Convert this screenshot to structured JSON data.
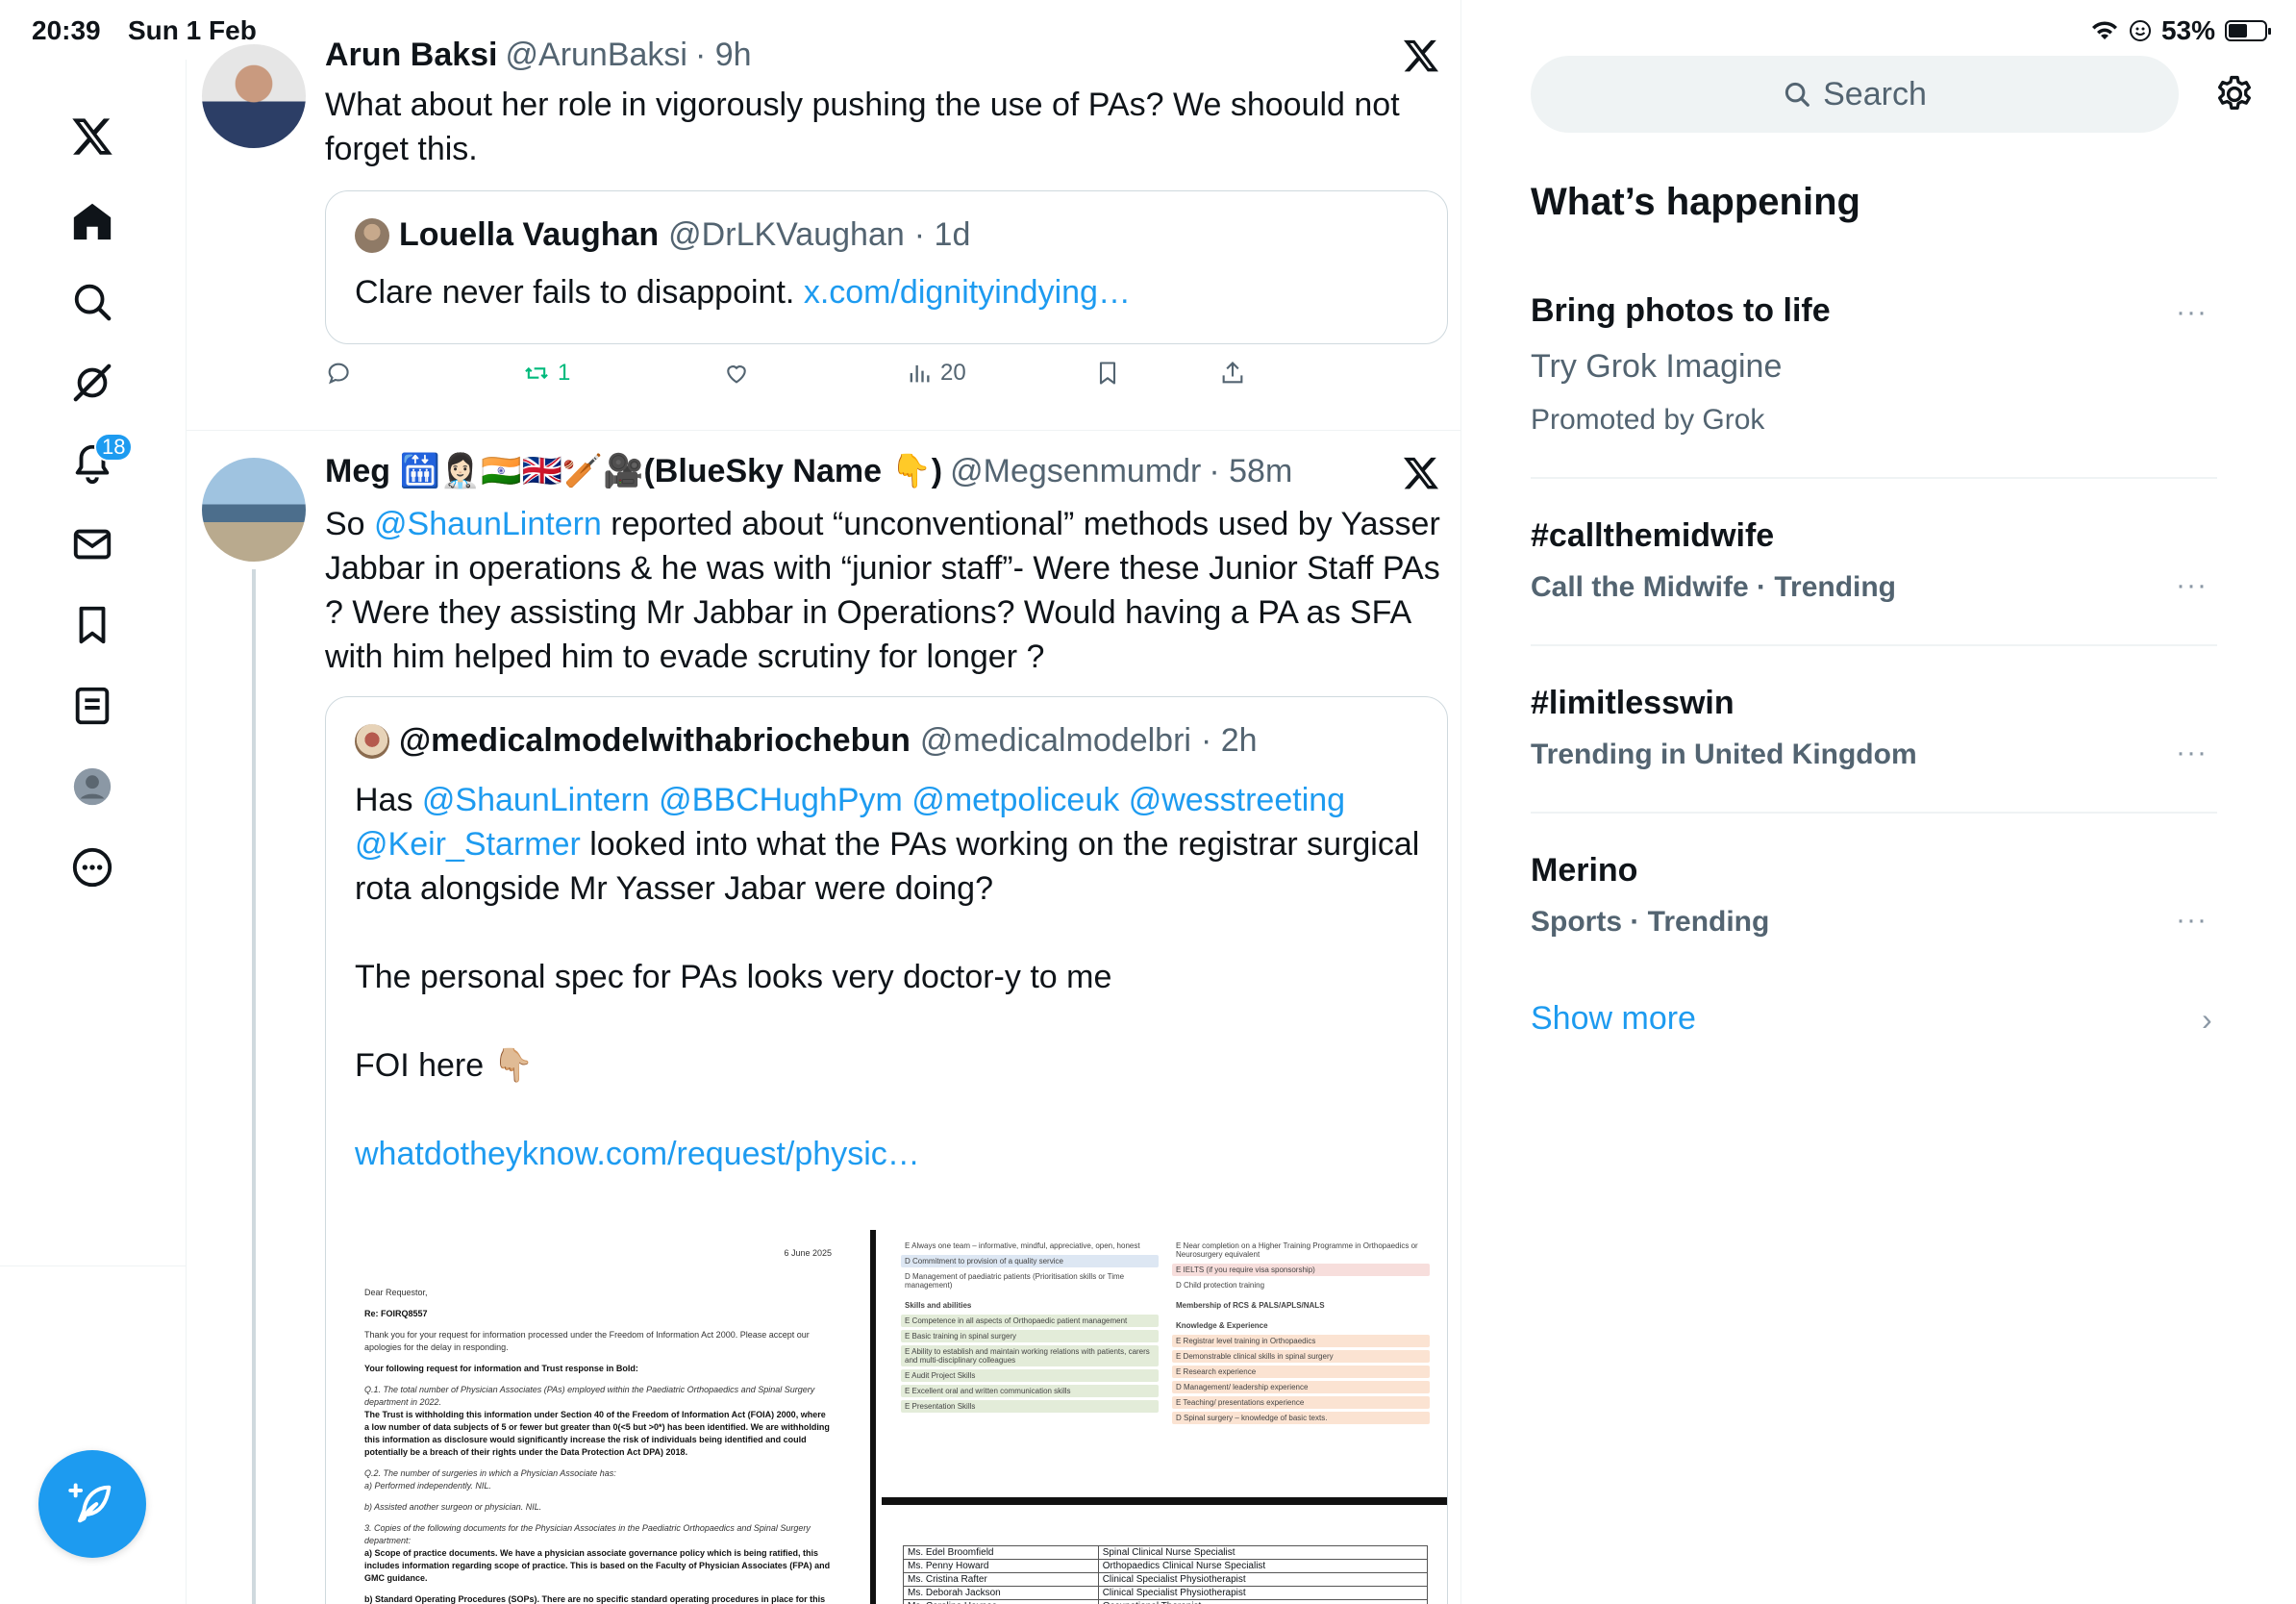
{
  "status": {
    "time": "20:39",
    "date": "Sun 1 Feb",
    "battery": "53%",
    "battery_level": 0.53
  },
  "nav": {
    "items": [
      {
        "name": "x-logo-icon"
      },
      {
        "name": "home-icon"
      },
      {
        "name": "search-icon"
      },
      {
        "name": "grok-icon"
      },
      {
        "name": "notifications-icon",
        "badge": "18"
      },
      {
        "name": "messages-icon"
      },
      {
        "name": "bookmarks-icon"
      },
      {
        "name": "lists-icon"
      },
      {
        "name": "profile-icon"
      },
      {
        "name": "more-icon"
      }
    ],
    "compose_icon": "compose-icon"
  },
  "tweets": [
    {
      "name": "Arun Baksi",
      "handle": "@ArunBaksi",
      "time": "· 9h",
      "text": "What about her role in vigorously pushing the use of PAs? We shoould not forget this.",
      "quote": {
        "name": "Louella Vaughan",
        "handle": "@DrLKVaughan",
        "time": "· 1d",
        "text": "Clare never fails to disappoint. ",
        "link": "x.com/dignityindying…"
      },
      "actions": {
        "reply": "",
        "retweet": "1",
        "like": "",
        "views": "20"
      }
    },
    {
      "name": "Meg 🛗👩🏻‍⚕️🇮🇳🇬🇧🏏🎥(BlueSky Name 👇)",
      "handle": "@Megsenmumdr",
      "time": "· 58m",
      "text_pre": "So ",
      "mention": "@ShaunLintern",
      "text_post": " reported about “unconventional” methods used by Yasser Jabbar in operations & he was with “junior staff”- Were these Junior Staff PAs ? Were they assisting Mr Jabbar in Operations? Would having a PA as SFA with him helped him to evade scrutiny for longer ?",
      "quote": {
        "name": "@medicalmodelwithabriochebun",
        "handle": "@medicalmodelbri",
        "time": "· 2h",
        "pre": "Has ",
        "mentions1": "@ShaunLintern @BBCHughPym @metpoliceuk @wesstreeting",
        "mentions2": "@Keir_Starmer",
        "text1": " looked into what the PAs working on the registrar surgical rota alongside Mr Yasser Jabar were doing?",
        "text2": "The personal spec for PAs looks very doctor-y to me",
        "text3": "FOI here 👇🏼",
        "link": "whatdotheyknow.com/request/physic…"
      },
      "doc": {
        "date": "6 June 2025",
        "greeting": "Dear Requestor,",
        "ref": "Re: FOIRQ8557",
        "p1": "Thank you for your request for information processed under the Freedom of Information Act 2000. Please accept our apologies for the delay in responding.",
        "p2": "Your following request for information and Trust response in Bold:",
        "p3": "Q.1. The total number of Physician Associates (PAs) employed within the Paediatric Orthopaedics and Spinal Surgery department in 2022.",
        "p4": "The Trust is withholding this information under Section 40 of the Freedom of Information Act (FOIA) 2000, where a low number of data subjects of 5 or fewer but greater than 0(<5 but >0*) has been identified. We are withholding this information as disclosure would significantly increase the risk of individuals being identified and could potentially be a breach of their rights under the Data Protection Act DPA) 2018.",
        "p5": "Q.2. The number of surgeries in which a Physician Associate has:",
        "p6": "a) Performed independently. NIL.",
        "p7": "b) Assisted another surgeon or physician. NIL.",
        "p8": "3. Copies of the following documents for the Physician Associates in the Paediatric Orthopaedics and Spinal Surgery department:",
        "p9": "a) Scope of practice documents. We have a physician associate governance policy which is being ratified, this includes information regarding scope of practice. This is based on the Faculty of Physician Associates (FPA) and GMC guidance.",
        "p10": "b) Standard Operating Procedures (SOPs). There are no specific standard operating procedures in place for this post. All aspects of the job are covered in the job description and by the Trust governance policy."
      },
      "spec": {
        "left": [
          {
            "code": "E",
            "text": "Always one team – informative, mindful, appreciative, open, honest"
          },
          {
            "code": "D",
            "text": "Commitment to provision of a quality service"
          },
          {
            "code": "D",
            "text": "Management of paediatric patients (Prioritisation skills or Time management)"
          },
          {
            "code": "",
            "text": "Skills and abilities"
          },
          {
            "code": "E",
            "text": "Competence in all aspects of Orthopaedic patient management"
          },
          {
            "code": "E",
            "text": "Basic training in spinal surgery"
          },
          {
            "code": "E",
            "text": "Ability to establish and maintain working relations with patients, carers and multi-disciplinary colleagues"
          },
          {
            "code": "E",
            "text": "Audit Project Skills"
          },
          {
            "code": "E",
            "text": "Excellent oral and written communication skills"
          },
          {
            "code": "E",
            "text": "Presentation Skills"
          }
        ],
        "right": [
          {
            "code": "E",
            "text": "Near completion on a Higher Training Programme in Orthopaedics or Neurosurgery equivalent"
          },
          {
            "code": "E",
            "text": "IELTS (if you require visa sponsorship)"
          },
          {
            "code": "D",
            "text": "Child protection training"
          },
          {
            "code": "",
            "text": "Membership of RCS & PALS/APLS/NALS"
          },
          {
            "code": "",
            "text": "Knowledge & Experience"
          },
          {
            "code": "E",
            "text": "Registrar level training in Orthopaedics"
          },
          {
            "code": "E",
            "text": "Demonstrable clinical skills in spinal surgery"
          },
          {
            "code": "E",
            "text": "Research experience"
          },
          {
            "code": "D",
            "text": "Management/ leadership experience"
          },
          {
            "code": "E",
            "text": "Teaching/ presentations experience"
          },
          {
            "code": "D",
            "text": "Spinal surgery – knowledge of basic texts."
          }
        ]
      },
      "staff": [
        [
          "Ms. Edel Broomfield",
          "Spinal Clinical Nurse Specialist"
        ],
        [
          "Ms. Penny Howard",
          "Orthopaedics Clinical Nurse Specialist"
        ],
        [
          "Ms. Cristina Rafter",
          "Clinical Specialist Physiotherapist"
        ],
        [
          "Ms. Deborah Jackson",
          "Clinical Specialist Physiotherapist"
        ],
        [
          "Ms. Caroline Haynes",
          "Occupational Therapist"
        ]
      ]
    }
  ],
  "right": {
    "search_label": "Search",
    "title": "What’s happening",
    "trends": [
      {
        "name": "Bring photos to life",
        "sub1": "Try Grok Imagine",
        "sub2": "Promoted by Grok",
        "more": "···"
      },
      {
        "name": "#callthemidwife",
        "sub1": "Call the Midwife · Trending",
        "more": "···"
      },
      {
        "name": "#limitlesswin",
        "sub1": "Trending in United Kingdom",
        "more": "···"
      },
      {
        "name": "Merino",
        "sub1": "Sports · Trending",
        "more": "···"
      }
    ],
    "show_more": "Show more"
  },
  "colors": {
    "accent": "#1d9bf0",
    "retweet_green": "#00ba7c",
    "text_primary": "#0f1419",
    "text_secondary": "#536471"
  }
}
